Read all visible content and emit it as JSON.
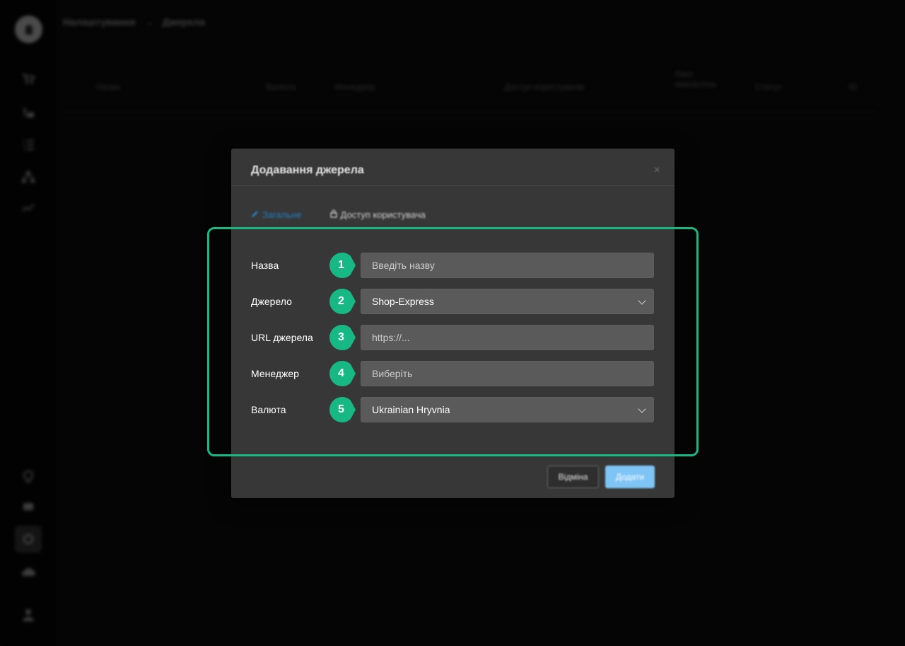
{
  "breadcrumb": {
    "parent": "Налаштування",
    "separator": "→",
    "current": "Джерела"
  },
  "table_headers": [
    "Назва",
    "Валюта",
    "Менеджер",
    "Доступ користувачів",
    "Ліміт замовлень",
    "Статус",
    "ID"
  ],
  "sidebar": {
    "icons": [
      "cart-icon",
      "delivery-icon",
      "list-icon",
      "hierarchy-icon",
      "chart-icon"
    ],
    "bottom_icons": [
      "bulb-icon",
      "chat-icon",
      "settings-icon",
      "cloud-icon",
      "user-icon"
    ]
  },
  "modal": {
    "title": "Додавання джерела",
    "close_symbol": "×",
    "tabs": [
      {
        "label": "Загальне",
        "icon": "edit-icon",
        "active": true
      },
      {
        "label": "Доступ користувача",
        "icon": "lock-icon",
        "active": false
      }
    ],
    "fields": [
      {
        "number": "1",
        "label": "Назва",
        "text": "Введіть назву",
        "kind": "input",
        "state": "placeholder"
      },
      {
        "number": "2",
        "label": "Джерело",
        "text": "Shop-Express",
        "kind": "select",
        "state": "value"
      },
      {
        "number": "3",
        "label": "URL джерела",
        "text": "https://...",
        "kind": "input",
        "state": "placeholder"
      },
      {
        "number": "4",
        "label": "Менеджер",
        "text": "Виберіть",
        "kind": "select-search",
        "state": "placeholder"
      },
      {
        "number": "5",
        "label": "Валюта",
        "text": "Ukrainian Hryvnia",
        "kind": "select",
        "state": "value"
      }
    ],
    "buttons": {
      "cancel": "Відміна",
      "add": "Додати"
    }
  },
  "colors": {
    "accent_green": "#18b884",
    "modal_bg": "#373737",
    "field_bg": "#5a5a5a",
    "primary_button": "#7ec4f5",
    "active_tab": "#1f7fc0"
  }
}
